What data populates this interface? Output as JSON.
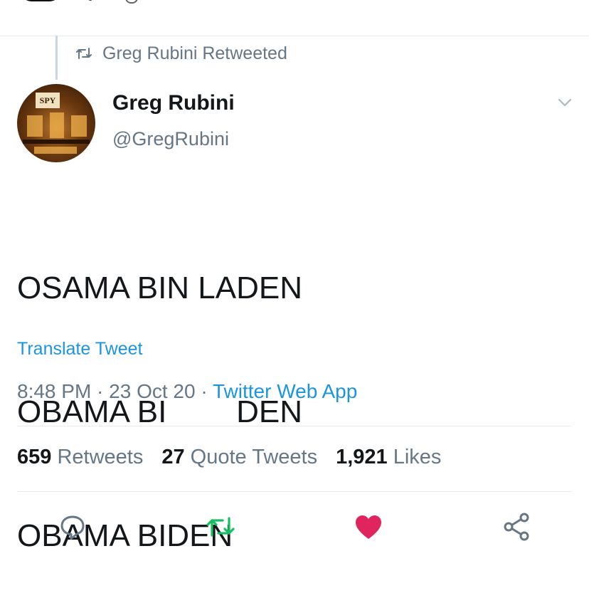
{
  "retweet_context": {
    "text": "Greg Rubini Retweeted"
  },
  "author": {
    "name": "Greg Rubini",
    "handle": "@GregRubini",
    "avatar_logo_text": "SPY"
  },
  "tweet": {
    "lines": [
      "OSAMA BIN LADEN",
      "OBAMA BI        DEN",
      "OBAMA BIDEN"
    ],
    "translate_label": "Translate Tweet"
  },
  "meta": {
    "time": "8:48 PM",
    "sep1": " · ",
    "date": "23 Oct 20",
    "sep2": " · ",
    "app": "Twitter Web App"
  },
  "stats": {
    "retweets_count": "659",
    "retweets_label": "Retweets",
    "quotes_count": "27",
    "quotes_label": "Quote Tweets",
    "likes_count": "1,921",
    "likes_label": "Likes"
  },
  "icons": {
    "reply": "reply-icon",
    "retweet": "retweet-icon",
    "like": "heart-icon",
    "share": "share-icon",
    "more": "chevron-down-icon",
    "retweeted_indicator": "retweet-small-icon"
  },
  "colors": {
    "link": "#1b95e0",
    "secondary_text": "#657786",
    "retweet_active": "#17bf63",
    "like_active": "#e0245e"
  }
}
